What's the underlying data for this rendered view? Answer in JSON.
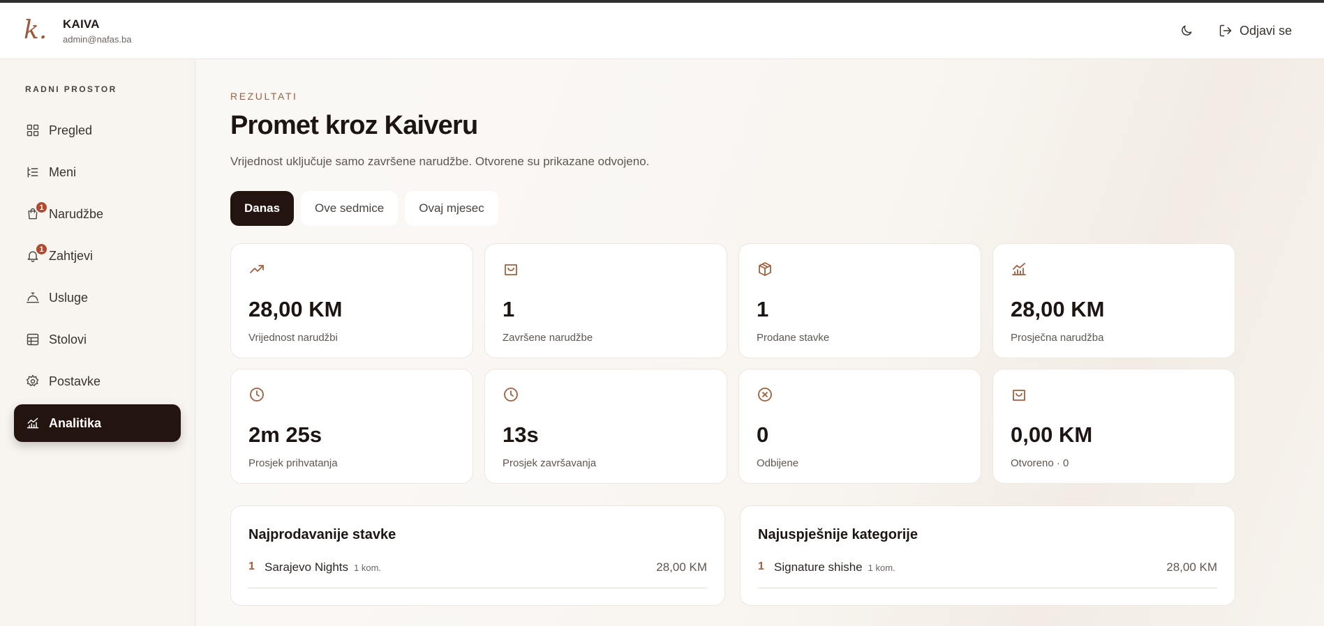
{
  "colors": {
    "accent": "#a0603f",
    "dark": "#24140f",
    "badge": "#b04a2e",
    "background": "#f8f5f1"
  },
  "header": {
    "logo_text": "k.",
    "brand_name": "KAIVA",
    "email": "admin@nafas.ba",
    "theme_icon": "moon-icon",
    "logout_label": "Odjavi se"
  },
  "sidebar": {
    "section_label": "RADNI PROSTOR",
    "items": [
      {
        "label": "Pregled",
        "icon": "grid-icon",
        "badge": null,
        "active": false
      },
      {
        "label": "Meni",
        "icon": "menu-list-icon",
        "badge": null,
        "active": false
      },
      {
        "label": "Narudžbe",
        "icon": "shopping-bag-icon",
        "badge": "1",
        "active": false
      },
      {
        "label": "Zahtjevi",
        "icon": "bell-icon",
        "badge": "1",
        "active": false
      },
      {
        "label": "Usluge",
        "icon": "service-bell-icon",
        "badge": null,
        "active": false
      },
      {
        "label": "Stolovi",
        "icon": "table-icon",
        "badge": null,
        "active": false
      },
      {
        "label": "Postavke",
        "icon": "gear-icon",
        "badge": null,
        "active": false
      },
      {
        "label": "Analitika",
        "icon": "chart-icon",
        "badge": null,
        "active": true
      }
    ]
  },
  "main": {
    "eyebrow": "REZULTATI",
    "title": "Promet kroz Kaiveru",
    "description": "Vrijednost uključuje samo završene narudžbe. Otvorene su prikazane odvojeno.",
    "tabs": [
      {
        "label": "Danas",
        "active": true
      },
      {
        "label": "Ove sedmice",
        "active": false
      },
      {
        "label": "Ovaj mjesec",
        "active": false
      }
    ],
    "stats": [
      {
        "icon": "trending-up-icon",
        "value": "28,00 KM",
        "label": "Vrijednost narudžbi"
      },
      {
        "icon": "shopping-bag-icon",
        "value": "1",
        "label": "Završene narudžbe"
      },
      {
        "icon": "package-icon",
        "value": "1",
        "label": "Prodane stavke"
      },
      {
        "icon": "chart-icon",
        "value": "28,00 KM",
        "label": "Prosječna narudžba"
      },
      {
        "icon": "clock-icon",
        "value": "2m 25s",
        "label": "Prosjek prihvatanja"
      },
      {
        "icon": "clock-icon",
        "value": "13s",
        "label": "Prosjek završavanja"
      },
      {
        "icon": "x-circle-icon",
        "value": "0",
        "label": "Odbijene"
      },
      {
        "icon": "shopping-bag-icon",
        "value": "0,00 KM",
        "label": "Otvoreno · 0"
      }
    ],
    "top_items": {
      "title": "Najprodavanije stavke",
      "rows": [
        {
          "rank": "1",
          "name": "Sarajevo Nights",
          "qty": "1 kom.",
          "amount": "28,00 KM"
        }
      ]
    },
    "top_categories": {
      "title": "Najuspješnije kategorije",
      "rows": [
        {
          "rank": "1",
          "name": "Signature shishe",
          "qty": "1 kom.",
          "amount": "28,00 KM"
        }
      ]
    }
  }
}
